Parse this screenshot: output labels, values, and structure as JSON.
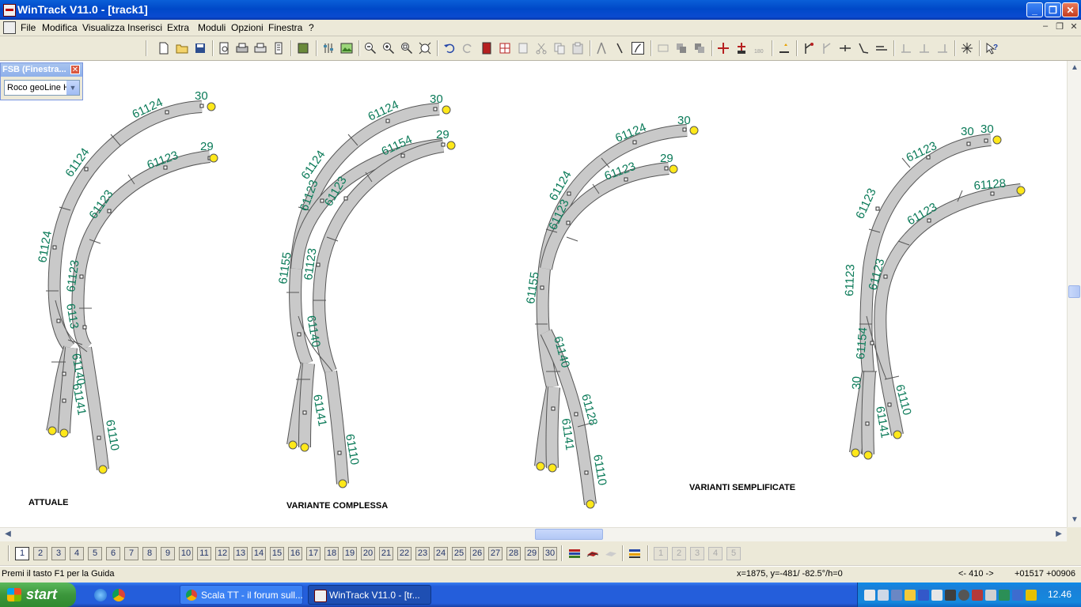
{
  "window": {
    "title": "WinTrack  V11.0 - [track1]",
    "min_glyph": "_",
    "max_glyph": "❐",
    "close_glyph": "✕"
  },
  "menu": {
    "items": [
      "File",
      "Modifica",
      "Visualizza",
      "Inserisci",
      "Extra",
      "Moduli",
      "Opzioni",
      "Finestra",
      "?"
    ]
  },
  "fsb": {
    "title": "FSB (Finestra...",
    "close_glyph": "✕",
    "select_value": "Roco geoLine H",
    "arrow_glyph": "▼"
  },
  "canvas": {
    "captions": [
      "ATTUALE",
      "VARIANTE COMPLESSA",
      "VARIANTI SEMPLIFICATE"
    ],
    "groups": [
      {
        "labels": [
          "30",
          "61124",
          "61124",
          "61124",
          "29",
          "61123",
          "61123",
          "61123",
          "6113",
          "61141",
          "61140",
          "61110"
        ]
      },
      {
        "labels": [
          "30",
          "61124",
          "61124",
          "29",
          "61154",
          "61123",
          "61123",
          "61155",
          "61123",
          "61140",
          "61141",
          "61110"
        ]
      },
      {
        "labels": [
          "30",
          "61124",
          "61124",
          "29",
          "61123",
          "61123",
          "61155",
          "61140",
          "61128",
          "61141",
          "61110"
        ]
      },
      {
        "labels": [
          "30",
          "30",
          "61123",
          "61123",
          "61128",
          "61123",
          "61123",
          "61123",
          "61154",
          "30",
          "61141",
          "61110"
        ]
      }
    ]
  },
  "layers": [
    "1",
    "2",
    "3",
    "4",
    "5",
    "6",
    "7",
    "8",
    "9",
    "10",
    "11",
    "12",
    "13",
    "14",
    "15",
    "16",
    "17",
    "18",
    "19",
    "20",
    "21",
    "22",
    "23",
    "24",
    "25",
    "26",
    "27",
    "28",
    "29",
    "30"
  ],
  "status": {
    "help": "Premi il tasto F1 per la Guida",
    "coords": "x=1875, y=-481/ -82.5°/h=0",
    "zoom": "<- 410 ->",
    "pos1": "+01517",
    "pos2": "+00906"
  },
  "taskbar": {
    "start": "start",
    "tasks": [
      "Scala TT - il forum sull...",
      "WinTrack  V11.0 - [tr..."
    ],
    "clock": "12.46"
  },
  "colors": {
    "track_fill": "#c9c9c9",
    "track_stroke": "#555555",
    "endpoint": "#ffe81a",
    "label": "#0a7a58",
    "titlebar": "#0054e3"
  }
}
